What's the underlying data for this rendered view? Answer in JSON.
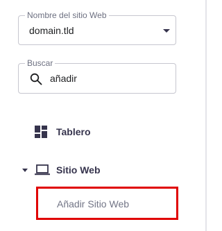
{
  "site_selector": {
    "label": "Nombre del sitio Web",
    "value": "domain.tld"
  },
  "search": {
    "label": "Buscar",
    "value": "añadir"
  },
  "nav": {
    "dashboard": "Tablero",
    "website": "Sitio Web",
    "website_children": [
      "Añadir Sitio Web"
    ]
  },
  "colors": {
    "highlight_border": "#e00000",
    "nav_text": "#36344d",
    "muted_text": "#727586"
  }
}
